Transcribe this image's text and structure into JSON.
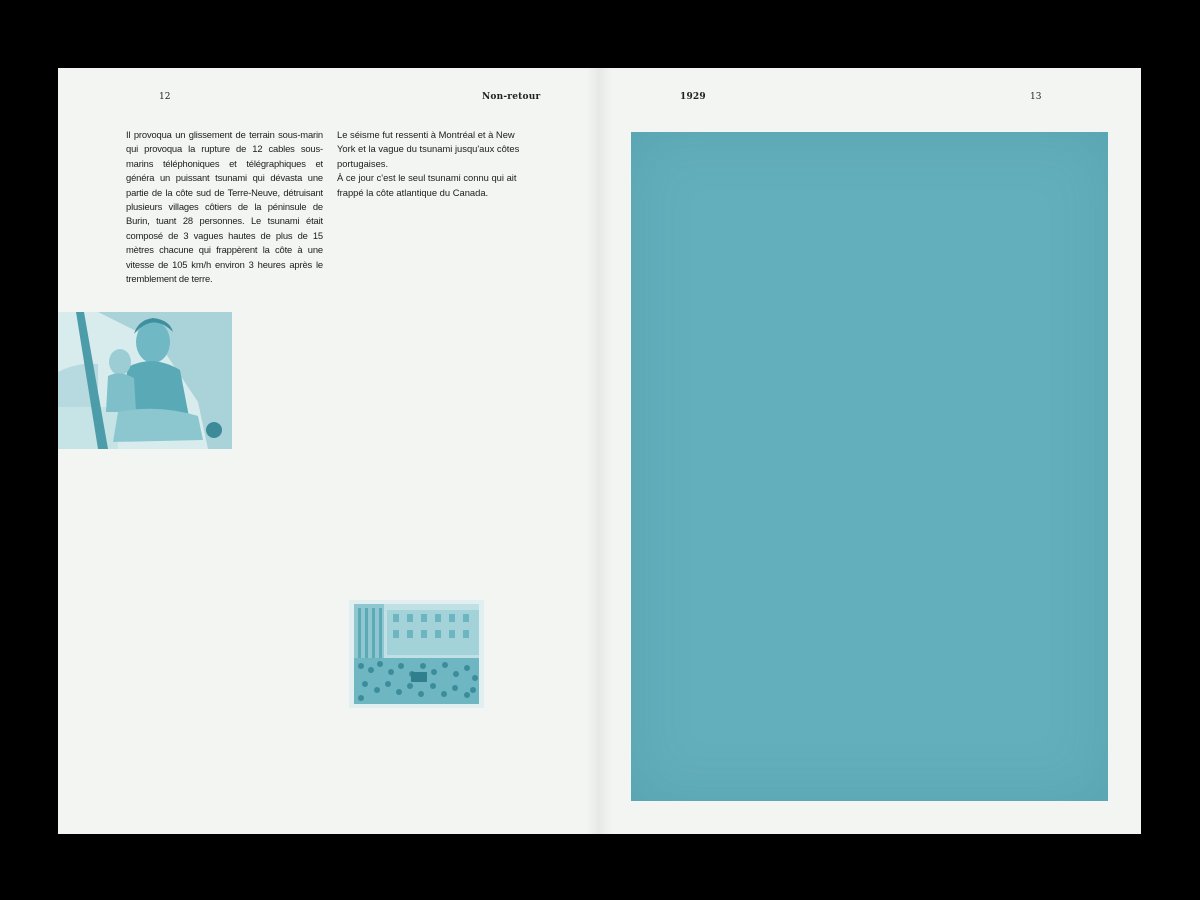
{
  "spread": {
    "left_page": {
      "folio": "12",
      "running_head": "Non-retour",
      "column1": {
        "text": "Il provoqua un glissement de terrain sous-marin qui provoqua la rupture de 12 cables sous-marins téléphoniques et télégraphiques et généra un puissant tsunami qui dévasta une partie de la côte sud de Terre-Neuve, détruisant plusieurs villages côtiers de la péninsule de Burin, tuant 28 personnes. Le tsunami était composé de 3 vagues hautes de plus de 15 mètres chacune qui frappèrent la côte à une vitesse de 105 km/h environ 3 heures après le tremblement de terre."
      },
      "column2": {
        "paragraph1": "Le séisme fut ressenti à Montréal et à New York et la vague du tsunami jusqu'aux côtes portugaises.",
        "paragraph2": "À ce jour c'est le seul tsunami connu qui ait frappé la côte atlantique du Canada."
      },
      "photos": {
        "portrait": {
          "subject": "woman-and-child-photo"
        },
        "crowd": {
          "subject": "street-crowd-photo"
        }
      }
    },
    "right_page": {
      "running_head": "1929",
      "folio": "13",
      "plate_color": "#64afbc"
    },
    "colors": {
      "paper": "#f3f5f2",
      "background": "#000000",
      "photo_tint": "#5fb0bd",
      "text": "#1c1c1c"
    }
  }
}
